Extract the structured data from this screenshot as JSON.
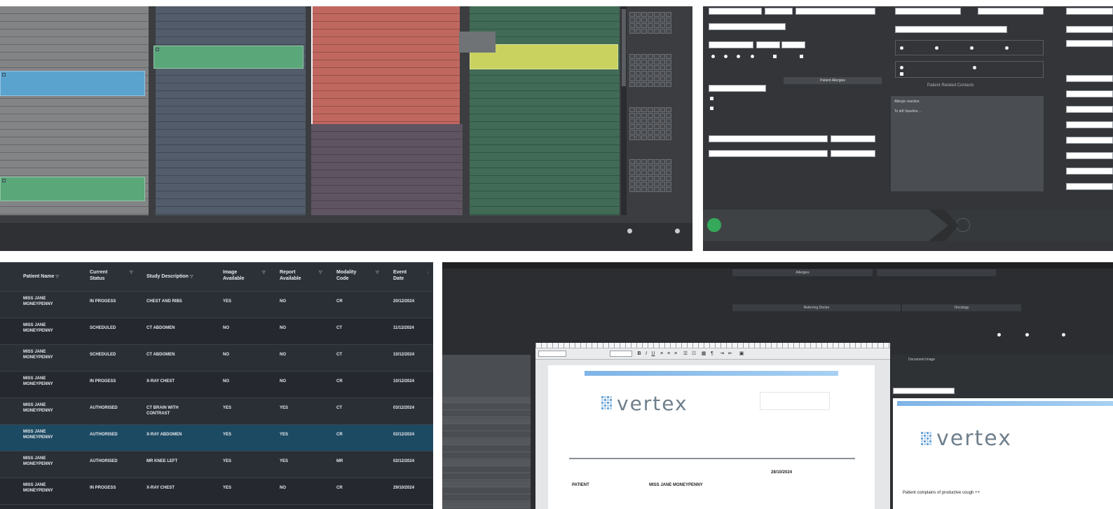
{
  "calendar": {
    "events": {
      "blue": [
        "",
        ""
      ],
      "green_a": [
        "",
        ""
      ],
      "green_b": [
        "",
        ""
      ],
      "yellow": [
        "",
        ""
      ]
    },
    "tooltip": [
      "",
      ""
    ],
    "mini_calendars": [
      "",
      "",
      "",
      ""
    ],
    "footer": {
      "left": "",
      "right": ""
    }
  },
  "patient_form": {
    "fields": {
      "title": "",
      "first": "",
      "surname": "",
      "phone": "",
      "dob": "",
      "age": "",
      "sex": "",
      "email": "",
      "right1": "",
      "right2": "",
      "right3": "",
      "right4": ""
    },
    "sections": {
      "conditions": "",
      "allergies_button": "Patient Allergies",
      "employment": "",
      "related_contacts": "Patient Related Contacts"
    },
    "allergy_notes": [
      "Allergic reaction",
      "To left Vaseline ...",
      ""
    ],
    "workflow": {
      "step1_title": "",
      "step1_status": "",
      "step2_title": "",
      "step2_status": ""
    },
    "add_label": ""
  },
  "worklist": {
    "columns": [
      "Patient Name",
      "Current Status",
      "Study Description",
      "Image Available",
      "Report Available",
      "Modality Code",
      "Event Date"
    ],
    "rows": [
      {
        "name": "MISS JANE MONEYPENNY",
        "status": "IN PROGESS",
        "study": "CHEST AND RIBS",
        "image": "YES",
        "report": "NO",
        "modality": "CR",
        "date": "20/12/2024"
      },
      {
        "name": "MISS JANE MONEYPENNY",
        "status": "SCHEDULED",
        "study": "CT ABDOMEN",
        "image": "NO",
        "report": "NO",
        "modality": "CT",
        "date": "11/12/2024"
      },
      {
        "name": "MISS JANE MONEYPENNY",
        "status": "SCHEDULED",
        "study": "CT ABDOMEN",
        "image": "NO",
        "report": "NO",
        "modality": "CT",
        "date": "10/12/2024"
      },
      {
        "name": "MISS JANE MONEYPENNY",
        "status": "IN PROGESS",
        "study": "X-RAY CHEST",
        "image": "NO",
        "report": "NO",
        "modality": "CR",
        "date": "10/12/2024"
      },
      {
        "name": "MISS JANE MONEYPENNY",
        "status": "AUTHORISED",
        "study": "CT BRAIN WITH CONTRAST",
        "image": "YES",
        "report": "YES",
        "modality": "CT",
        "date": "03/12/2024"
      },
      {
        "name": "MISS JANE MONEYPENNY",
        "status": "AUTHORISED",
        "study": "X-RAY ABDOMEN",
        "image": "YES",
        "report": "YES",
        "modality": "CR",
        "date": "02/12/2024"
      },
      {
        "name": "MISS JANE MONEYPENNY",
        "status": "AUTHORISED",
        "study": "MR KNEE LEFT",
        "image": "YES",
        "report": "YES",
        "modality": "MR",
        "date": "02/12/2024"
      },
      {
        "name": "MISS JANE MONEYPENNY",
        "status": "IN PROGESS",
        "study": "X-RAY CHEST",
        "image": "YES",
        "report": "NO",
        "modality": "CR",
        "date": "29/10/2024"
      }
    ]
  },
  "report": {
    "tabs": [
      "",
      "",
      ""
    ],
    "top_labels": {
      "allergies": "Allergies",
      "alerts": "",
      "referring": "Referring Doctor",
      "oncology": "Oncology"
    },
    "error_message": "",
    "side_red": [
      "",
      ""
    ],
    "left_tabs": [
      "",
      ""
    ],
    "logo_text": "vertex",
    "doc_date": "28/10/2024",
    "doc_patient_label": "PATIENT",
    "doc_patient_value": "MISS JANE MONEYPENNY",
    "right_tabs": [
      "",
      "Document Image",
      "",
      ""
    ],
    "right_text": "Patient complains of productive cough ++"
  },
  "colors": {
    "blue_event": "#5ba3cf",
    "green_event": "#5aa77a",
    "yellow_event": "#c9d25f",
    "salmon_col": "#c0675f",
    "purple_col": "#5f5462",
    "selected_row": "#1d4a63",
    "workflow_done": "#35a85a",
    "error_red": "#e14c4c"
  }
}
